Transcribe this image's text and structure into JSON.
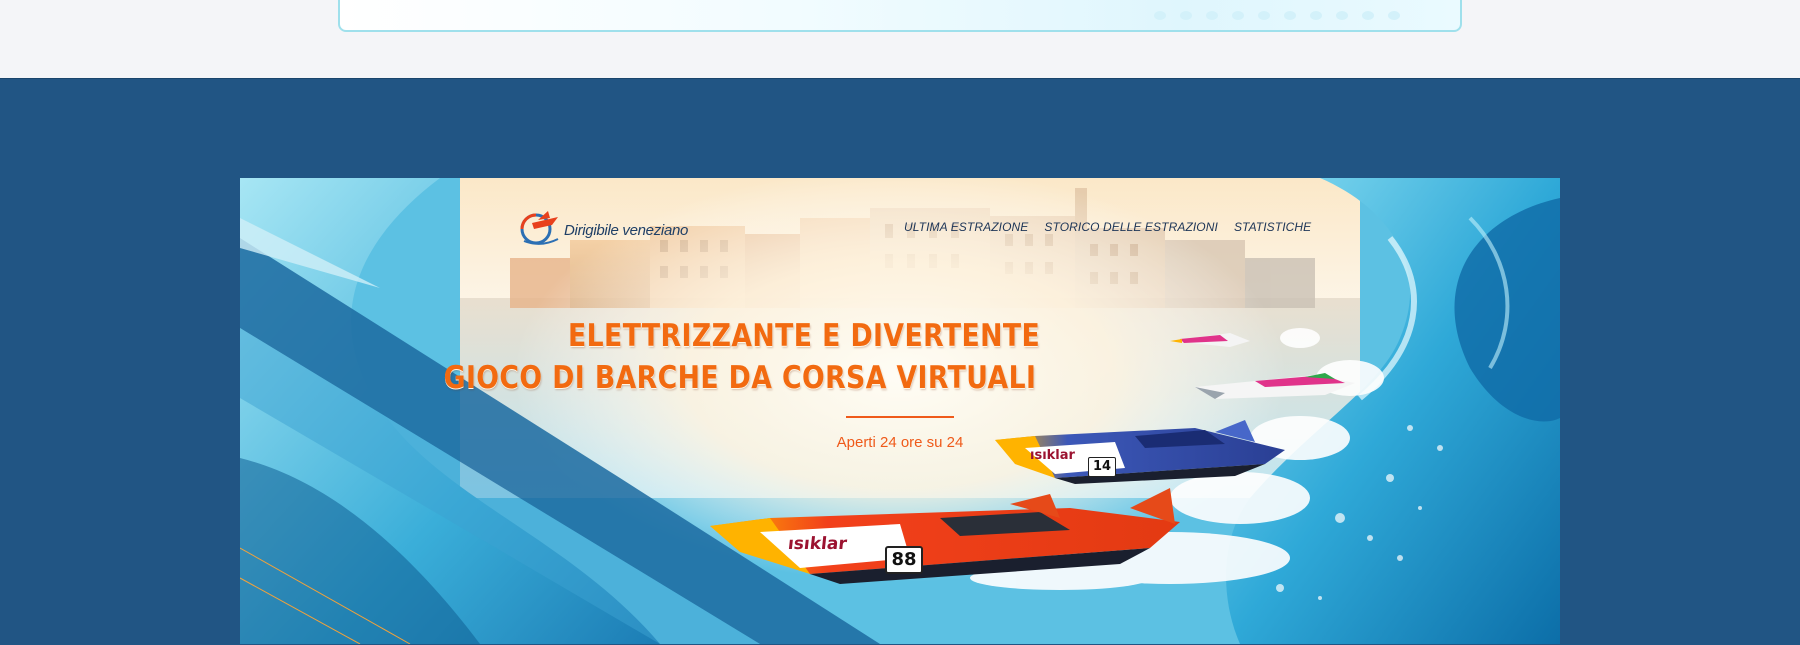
{
  "banner": {
    "logo_text": "Dirigibile veneziano",
    "nav": [
      {
        "label": "ULTIMA ESTRAZIONE"
      },
      {
        "label": "STORICO DELLE ESTRAZIONI"
      },
      {
        "label": "STATISTICHE"
      }
    ],
    "headline_line1": "ELETTRIZZANTE E DIVERTENTE",
    "headline_line2": "GIOCO DI BARCHE DA CORSA VIRTUALI",
    "tagline": "Aperti 24 ore su 24",
    "boats": [
      {
        "sponsor": "ısıklar",
        "number": "88"
      },
      {
        "sponsor": "ısıklar",
        "number": "14"
      }
    ]
  },
  "colors": {
    "section_background": "#215584",
    "page_background": "#f4f5f8",
    "headline": "#f26a10",
    "nav_text": "#1d3557"
  },
  "icons": [
    "logo-emblem-icon"
  ]
}
